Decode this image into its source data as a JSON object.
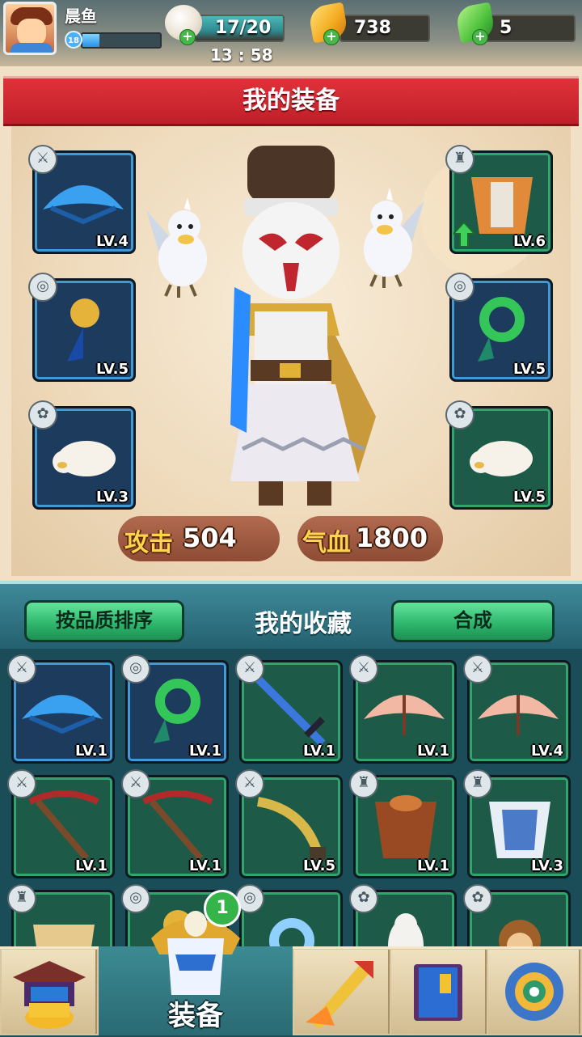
{
  "top_bar": {
    "player_name": "晨鱼",
    "player_level": "18",
    "xp_fraction": 0.22,
    "stamina": "17/20",
    "stamina_timer": "13 : 58",
    "gold": "738",
    "jade": "5",
    "plus_symbol": "+"
  },
  "equipment": {
    "title": "我的装备",
    "left_slots": [
      {
        "item": "blue-fan-icon",
        "level": "LV.4",
        "type": "sword-badge-icon",
        "frame": "blue"
      },
      {
        "item": "gold-pendant-icon",
        "level": "LV.5",
        "type": "ring-badge-icon",
        "frame": "blue"
      },
      {
        "item": "white-bird-pet-icon",
        "level": "LV.3",
        "type": "paw-badge-icon",
        "frame": "blue"
      }
    ],
    "right_slots": [
      {
        "item": "orange-armor-icon",
        "level": "LV.6",
        "type": "armor-badge-icon",
        "frame": "green",
        "upgrade": true
      },
      {
        "item": "green-jade-ring-icon",
        "level": "LV.5",
        "type": "ring-badge-icon",
        "frame": "blue"
      },
      {
        "item": "white-bird-pet-icon",
        "level": "LV.5",
        "type": "paw-badge-icon",
        "frame": "green"
      }
    ],
    "attack_label": "攻击",
    "attack_value": "504",
    "hp_label": "气血",
    "hp_value": "1800"
  },
  "collection": {
    "sort_button": "按品质排序",
    "title": "我的收藏",
    "combine_button": "合成",
    "items": [
      {
        "item": "blue-fan-icon",
        "level": "LV.1",
        "type": "sword-badge-icon",
        "frame": "blue"
      },
      {
        "item": "green-jade-ring-icon",
        "level": "LV.1",
        "type": "ring-badge-icon",
        "frame": "blue"
      },
      {
        "item": "blue-sword-icon",
        "level": "LV.1",
        "type": "sword-badge-icon",
        "frame": "green"
      },
      {
        "item": "pink-fan-icon",
        "level": "LV.1",
        "type": "sword-badge-icon",
        "frame": "green"
      },
      {
        "item": "pink-fan-icon",
        "level": "LV.4",
        "type": "sword-badge-icon",
        "frame": "green"
      },
      {
        "item": "crossbow-icon",
        "level": "LV.1",
        "type": "sword-badge-icon",
        "frame": "green"
      },
      {
        "item": "crossbow-icon",
        "level": "LV.1",
        "type": "sword-badge-icon",
        "frame": "green"
      },
      {
        "item": "horn-blade-icon",
        "level": "LV.5",
        "type": "sword-badge-icon",
        "frame": "green"
      },
      {
        "item": "brown-armor-icon",
        "level": "LV.1",
        "type": "armor-badge-icon",
        "frame": "green"
      },
      {
        "item": "blue-white-robe-icon",
        "level": "LV.3",
        "type": "armor-badge-icon",
        "frame": "green"
      },
      {
        "item": "yellow-robe-icon",
        "level": "",
        "type": "armor-badge-icon",
        "frame": "green"
      },
      {
        "item": "gold-pendant-icon",
        "level": "",
        "type": "ring-badge-icon",
        "frame": "green"
      },
      {
        "item": "blue-ring-icon",
        "level": "",
        "type": "ring-badge-icon",
        "frame": "green"
      },
      {
        "item": "ferret-pet-icon",
        "level": "",
        "type": "paw-badge-icon",
        "frame": "green"
      },
      {
        "item": "monkey-pet-icon",
        "level": "",
        "type": "paw-badge-icon",
        "frame": "green"
      }
    ]
  },
  "bottom_nav": {
    "tabs": [
      {
        "name": "shop-pagoda-icon"
      },
      {
        "name": "equipment-armor-icon",
        "label": "装备",
        "active": true,
        "badge": "1"
      },
      {
        "name": "forge-sword-icon"
      },
      {
        "name": "book-icon"
      },
      {
        "name": "settings-gear-icon"
      }
    ]
  },
  "colors": {
    "ribbon_red": "#d42a33",
    "frame_blue": "#3f9ad6",
    "frame_green": "#2fa66c",
    "stat_gold": "#ffd44a",
    "button_green": "#2cb56a"
  }
}
